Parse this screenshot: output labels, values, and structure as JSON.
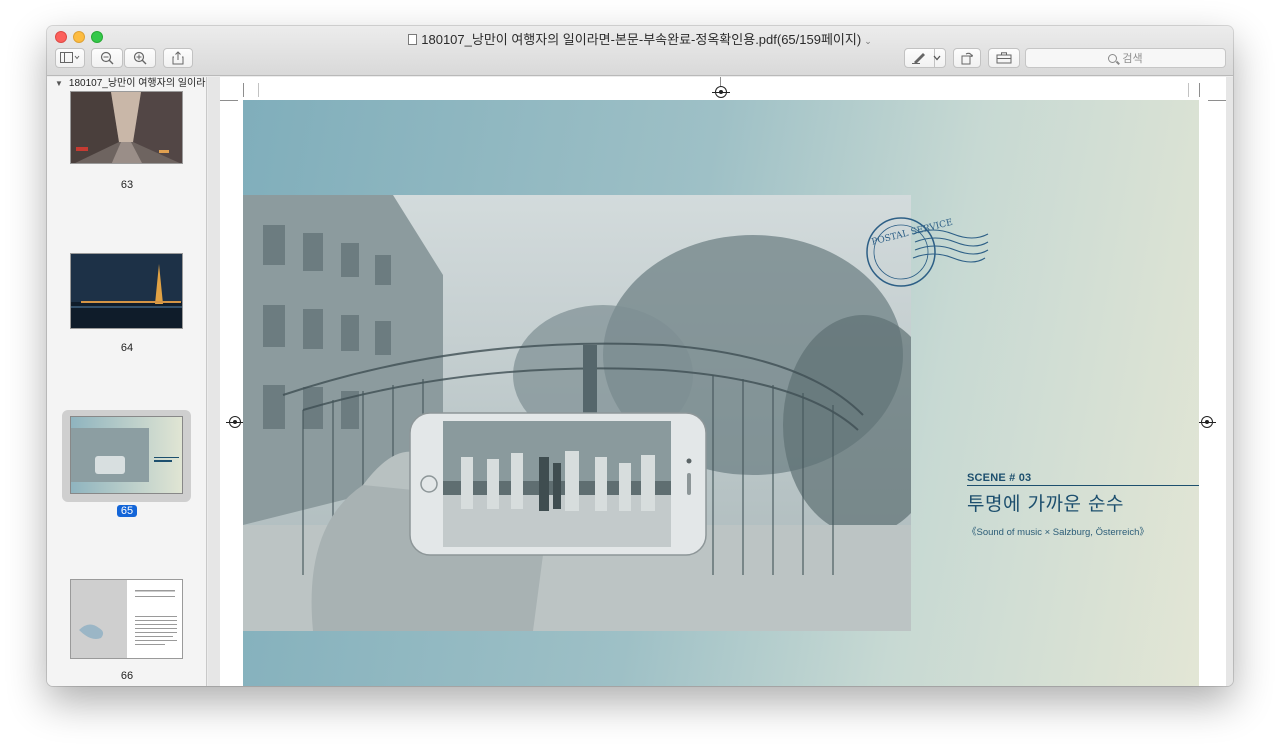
{
  "window": {
    "title": "180107_낭만이 여행자의 일이라면-본문-부속완료-정옥확인용.pdf(65/159페이지)",
    "title_chevron": "⌄"
  },
  "toolbar": {
    "sidebar_toggle_icon": "sidebar-icon",
    "zoom_out_icon": "zoom-out-icon",
    "zoom_in_icon": "zoom-in-icon",
    "share_icon": "share-icon",
    "markup_icon": "pen-icon",
    "rotate_icon": "rotate-icon",
    "toolbox_icon": "toolbox-icon",
    "search_placeholder": "검색"
  },
  "sidebar": {
    "document_name": "180107_낭만이 여행자의 일이라...",
    "thumbnails": [
      {
        "page": "63",
        "selected": false
      },
      {
        "page": "64",
        "selected": false
      },
      {
        "page": "65",
        "selected": true
      },
      {
        "page": "66",
        "selected": false
      }
    ]
  },
  "page_content": {
    "stamp_text": "POSTAL SERVICE",
    "scene_tag": "SCENE # 03",
    "scene_title": "투명에 가까운 순수",
    "scene_subtitle": "《Sound of music × Salzburg, Österreich》"
  },
  "colors": {
    "accent_selection": "#1365d8",
    "scene_text": "#1d4f6e",
    "spread_teal": "#80aebb",
    "spread_cream": "#e3e6d5"
  }
}
